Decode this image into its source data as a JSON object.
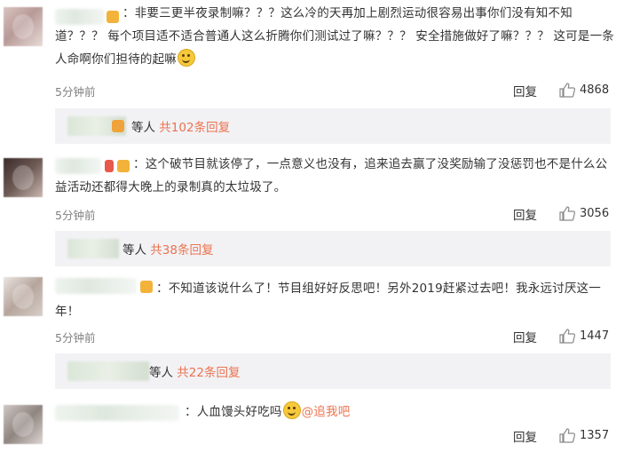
{
  "comments": [
    {
      "text": "：非要三更半夜录制嘛？？？这么冷的天再加上剧烈运动很容易出事你们没有知不知道？？？  每个项目适不适合普通人这么折腾你们测试过了嘛？？？  安全措施做好了嘛？？？  这可是一条人命啊你们担待的起嘛",
      "time": "5分钟前",
      "reply_label": "回复",
      "likes": "4868",
      "sub_prefix": "等人",
      "sub_count": "共102条回复"
    },
    {
      "text": "：这个破节目就该停了，一点意义也没有，追来追去赢了没奖励输了没惩罚也不是什么公益活动还都得大晚上的录制真的太垃圾了。",
      "time": "5分钟前",
      "reply_label": "回复",
      "likes": "3056",
      "sub_prefix": "等人",
      "sub_count": "共38条回复"
    },
    {
      "text": "：不知道该说什么了！节目组好好反思吧！另外2019赶紧过去吧！我永远讨厌这一年！",
      "time": "5分钟前",
      "reply_label": "回复",
      "likes": "1447",
      "sub_prefix": "等人",
      "sub_count": "共22条回复"
    },
    {
      "text": "：人血馒头好吃吗",
      "link": "@追我吧",
      "reply_label": "回复",
      "likes": "1357"
    }
  ]
}
